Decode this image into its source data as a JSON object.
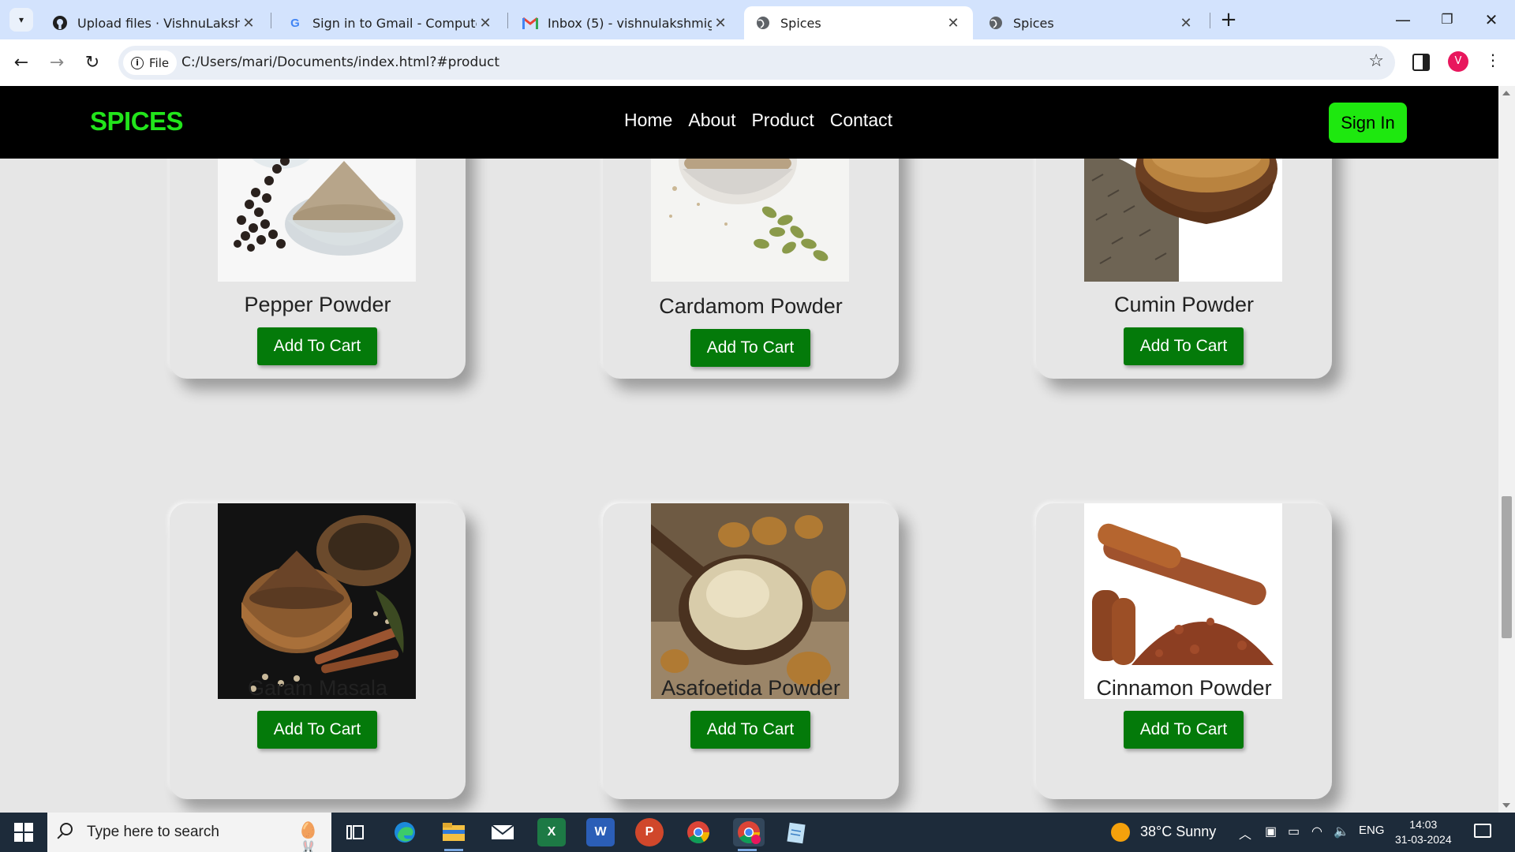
{
  "browser": {
    "tabs": [
      {
        "title": "Upload files · VishnuLakshmi-G",
        "icon": "github-icon"
      },
      {
        "title": "Sign in to Gmail - Computer - G",
        "icon": "google-icon"
      },
      {
        "title": "Inbox (5) - vishnulakshmig2004",
        "icon": "gmail-icon"
      },
      {
        "title": "Spices",
        "icon": "globe-icon"
      },
      {
        "title": "Spices",
        "icon": "globe-icon"
      }
    ],
    "active_tab": 3,
    "address": {
      "chip_label": "File",
      "url": "C:/Users/mari/Documents/index.html?#product"
    },
    "profile_initial": "V"
  },
  "site": {
    "logo": "SPICES",
    "nav": [
      "Home",
      "About",
      "Product",
      "Contact"
    ],
    "signin_label": "Sign In",
    "colors": {
      "logo": "#22e51b",
      "signin": "#1ee80f",
      "cart": "#047a0a"
    }
  },
  "products": [
    {
      "name": "Pepper Powder",
      "button": "Add To Cart"
    },
    {
      "name": "Cardamom Powder",
      "button": "Add To Cart"
    },
    {
      "name": "Cumin Powder",
      "button": "Add To Cart"
    },
    {
      "name": "Garam Masala",
      "button": "Add To Cart"
    },
    {
      "name": "Asafoetida Powder",
      "button": "Add To Cart"
    },
    {
      "name": "Cinnamon Powder",
      "button": "Add To Cart"
    }
  ],
  "taskbar": {
    "search_placeholder": "Type here to search",
    "weather": "38°C  Sunny",
    "language": "ENG",
    "time": "14:03",
    "date": "31-03-2024",
    "apps": [
      "task-view-icon",
      "edge-icon",
      "file-explorer-icon",
      "mail-icon",
      "excel-icon",
      "word-icon",
      "powerpoint-icon",
      "chrome-icon",
      "chrome-profile-icon",
      "notepad-icon"
    ]
  }
}
